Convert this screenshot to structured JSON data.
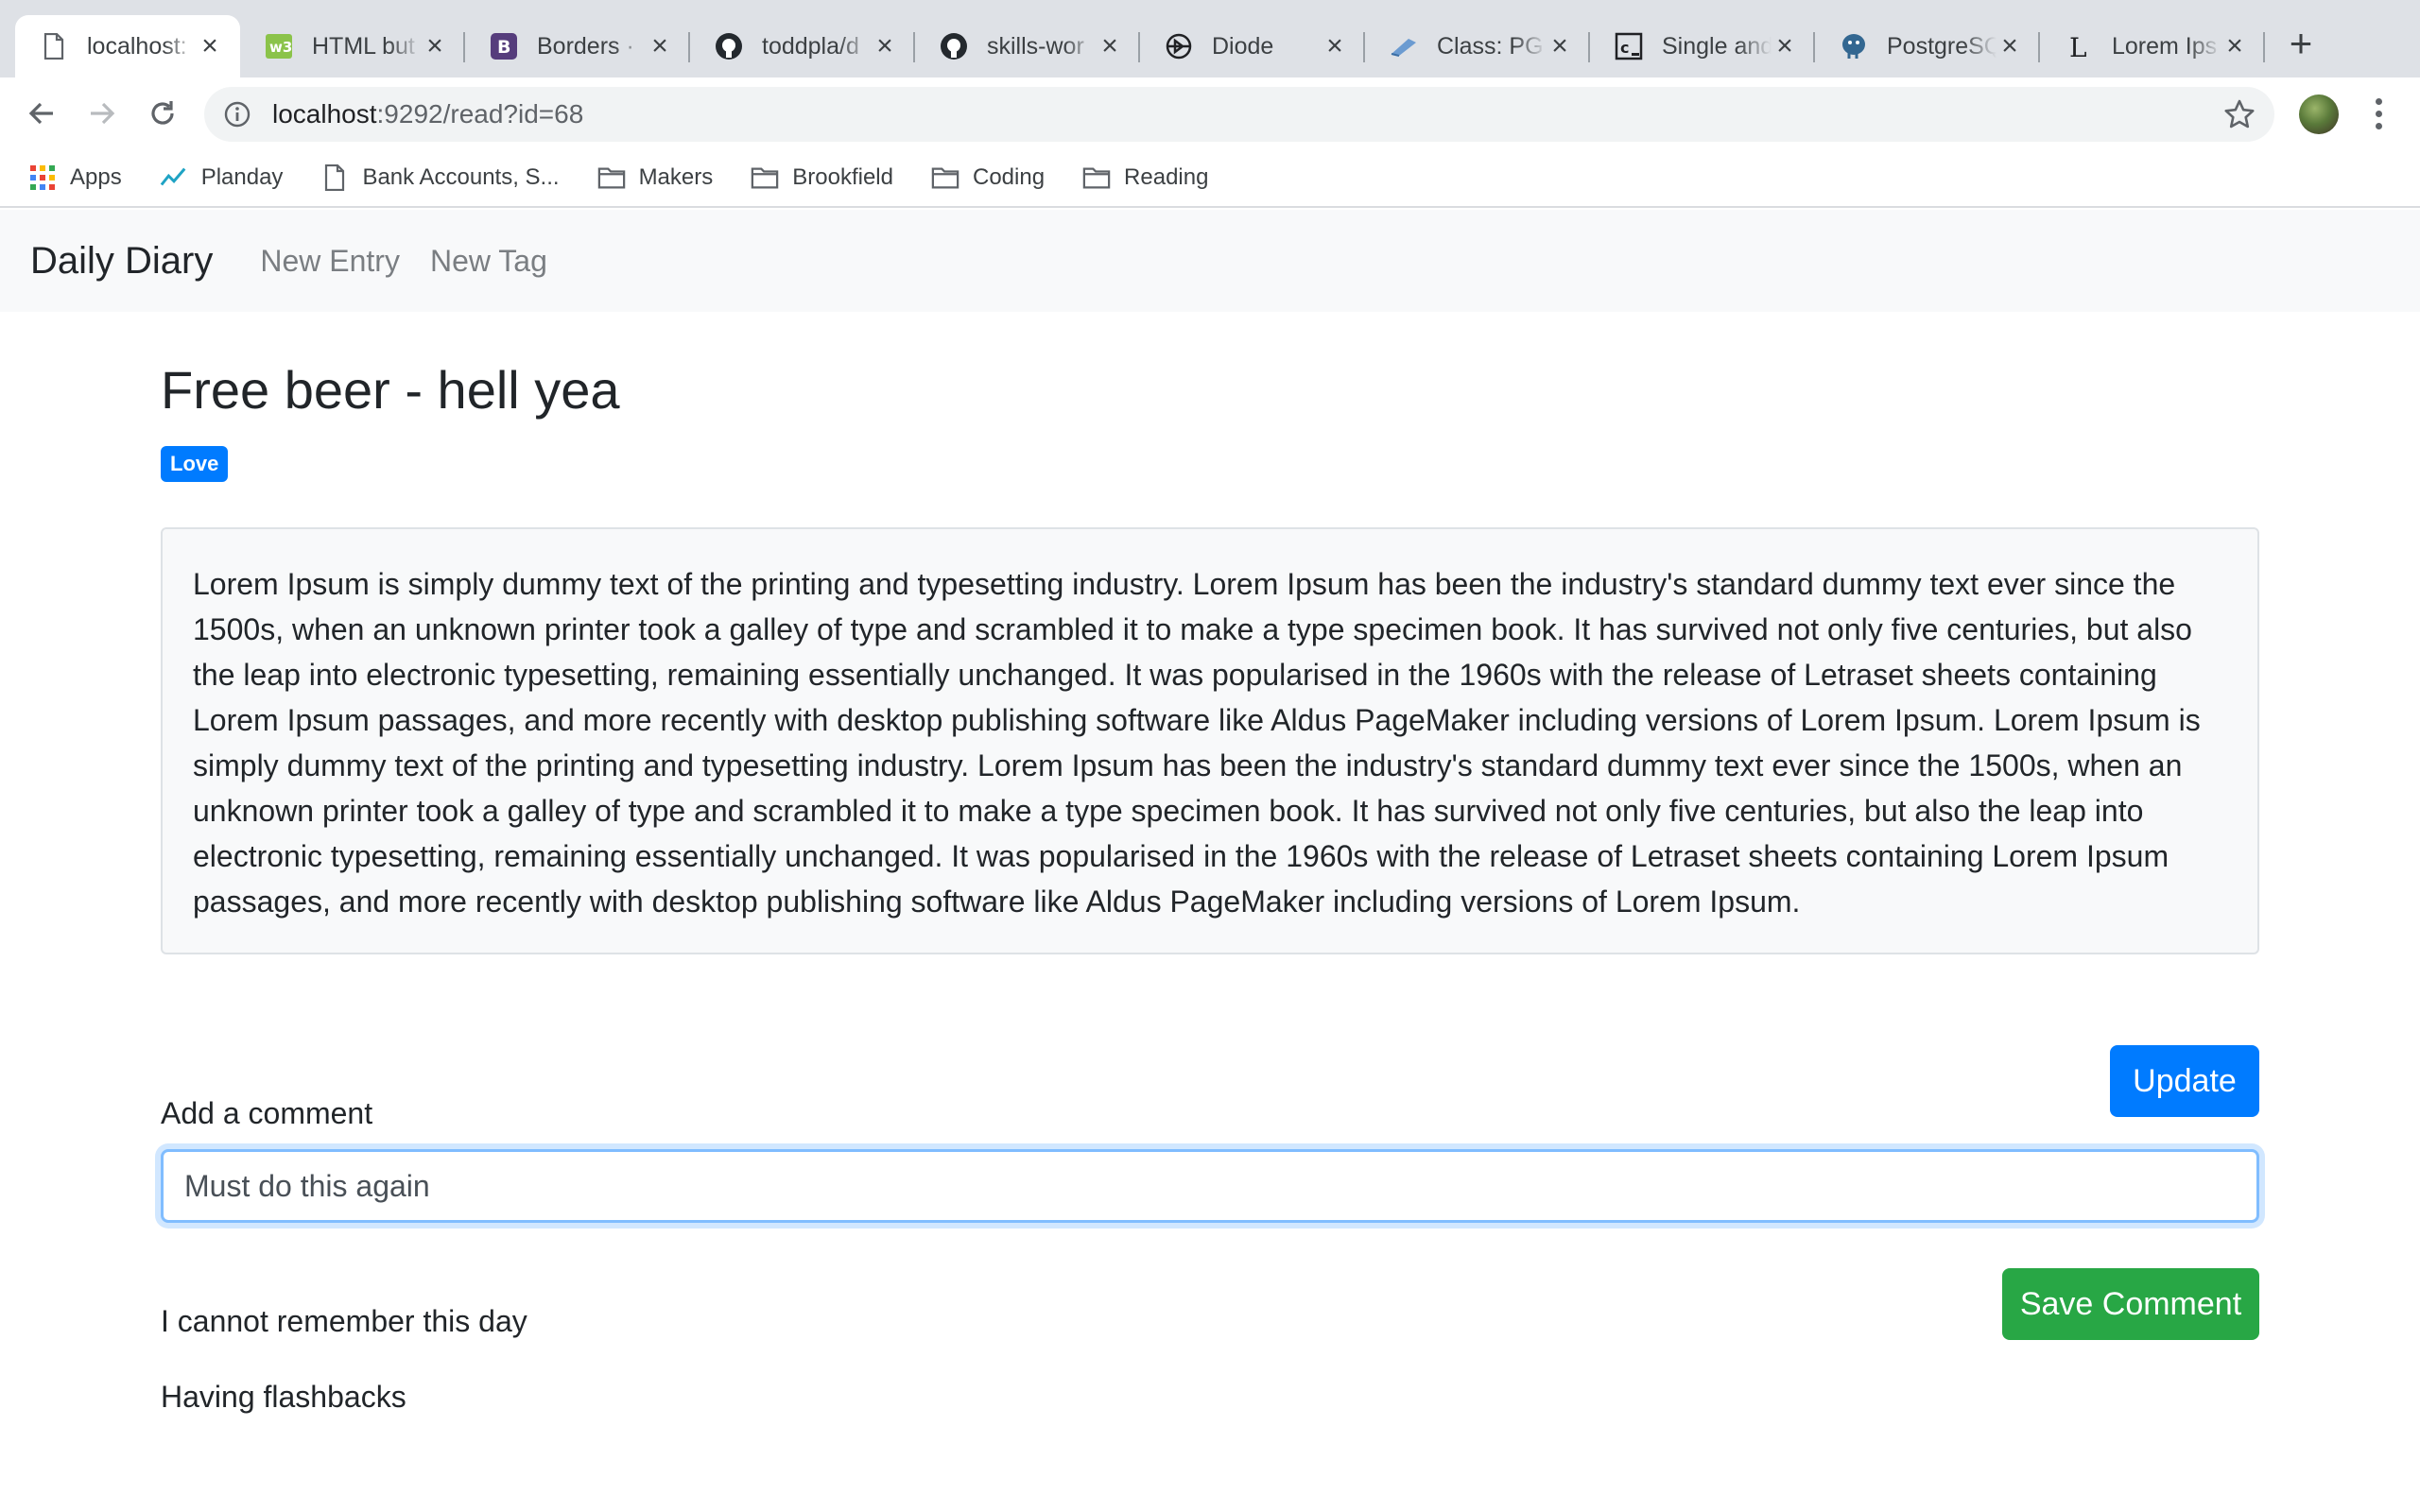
{
  "browser": {
    "tabs": [
      {
        "title": "localhost:",
        "icon": "page-icon",
        "active": true
      },
      {
        "title": "HTML but",
        "icon": "w3schools-icon",
        "active": false
      },
      {
        "title": "Borders ·",
        "icon": "bootstrap-icon",
        "active": false
      },
      {
        "title": "toddpla/d",
        "icon": "github-icon",
        "active": false
      },
      {
        "title": "skills-wor",
        "icon": "github-icon",
        "active": false
      },
      {
        "title": "Diode",
        "icon": "diode-icon",
        "active": false
      },
      {
        "title": "Class: PG",
        "icon": "class-icon",
        "active": false
      },
      {
        "title": "Single and",
        "icon": "codecademy-icon",
        "active": false
      },
      {
        "title": "PostgreSQ",
        "icon": "postgres-icon",
        "active": false
      },
      {
        "title": "Lorem Ips",
        "icon": "lorem-icon",
        "active": false
      }
    ],
    "address": {
      "host": "localhost",
      "path": ":9292/read?id=68"
    },
    "bookmarks": [
      {
        "label": "Apps",
        "icon": "apps-grid-icon"
      },
      {
        "label": "Planday",
        "icon": "planday-icon"
      },
      {
        "label": "Bank Accounts, S...",
        "icon": "page-icon"
      },
      {
        "label": "Makers",
        "icon": "folder-icon"
      },
      {
        "label": "Brookfield",
        "icon": "folder-icon"
      },
      {
        "label": "Coding",
        "icon": "folder-icon"
      },
      {
        "label": "Reading",
        "icon": "folder-icon"
      }
    ]
  },
  "navbar": {
    "brand": "Daily Diary",
    "links": [
      "New Entry",
      "New Tag"
    ]
  },
  "entry": {
    "title": "Free beer - hell yea",
    "tag": "Love",
    "tag_color": "#007bff",
    "body": "Lorem Ipsum is simply dummy text of the printing and typesetting industry. Lorem Ipsum has been the industry's standard dummy text ever since the 1500s, when an unknown printer took a galley of type and scrambled it to make a type specimen book. It has survived not only five centuries, but also the leap into electronic typesetting, remaining essentially unchanged. It was popularised in the 1960s with the release of Letraset sheets containing Lorem Ipsum passages, and more recently with desktop publishing software like Aldus PageMaker including versions of Lorem Ipsum. Lorem Ipsum is simply dummy text of the printing and typesetting industry. Lorem Ipsum has been the industry's standard dummy text ever since the 1500s, when an unknown printer took a galley of type and scrambled it to make a type specimen book. It has survived not only five centuries, but also the leap into electronic typesetting, remaining essentially unchanged. It was popularised in the 1960s with the release of Letraset sheets containing Lorem Ipsum passages, and more recently with desktop publishing software like Aldus PageMaker including versions of Lorem Ipsum.",
    "update_label": "Update"
  },
  "comment_form": {
    "label": "Add a comment",
    "value": "Must do this again",
    "save_label": "Save Comment"
  },
  "comments": [
    "I cannot remember this day",
    "Having flashbacks"
  ],
  "colors": {
    "primary": "#007bff",
    "success": "#28a745",
    "navbar_bg": "#f8f9fa"
  }
}
